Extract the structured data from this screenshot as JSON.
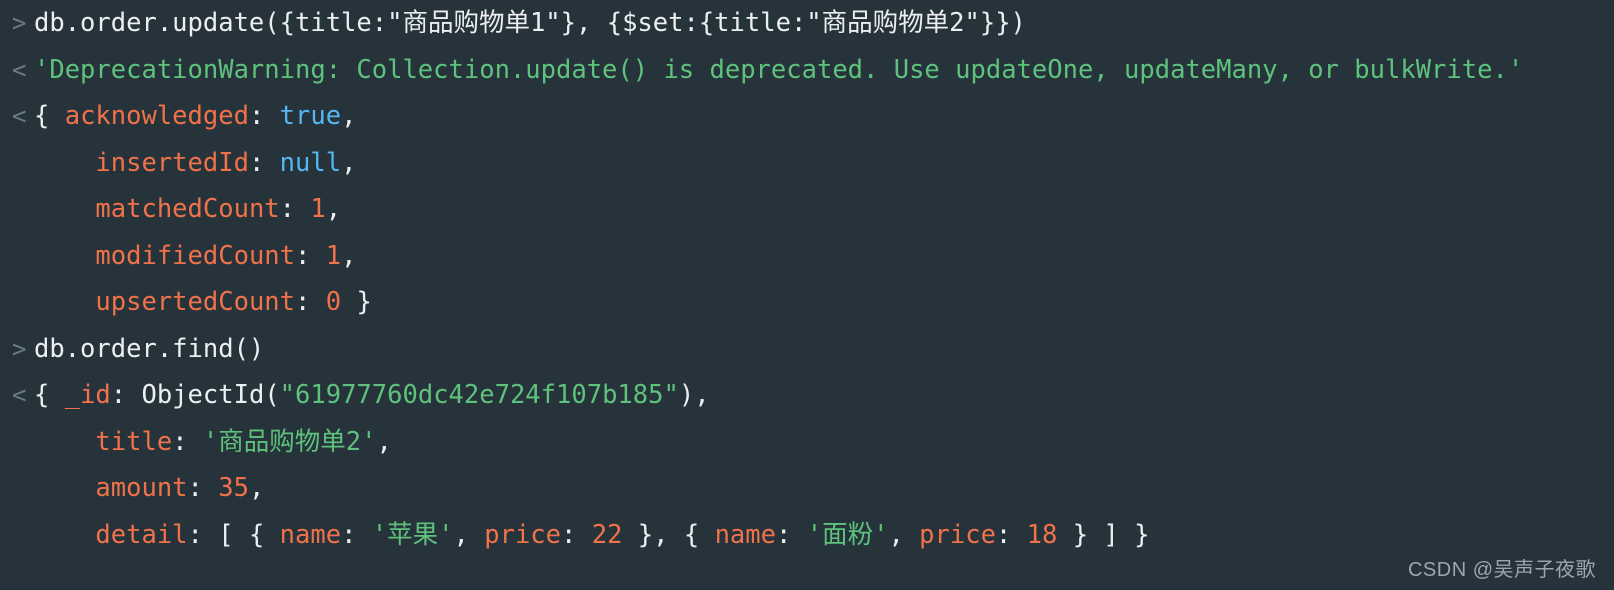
{
  "terminal": {
    "background_color": "#26333b",
    "prompt_in_glyph": ">",
    "prompt_out_glyph": "<",
    "colors": {
      "plain": "#eceff1",
      "key": "#f0724a",
      "number": "#f0724a",
      "string": "#5ec27c",
      "boolean": "#56b6f2",
      "prompt": "#6b7b84"
    },
    "lines": [
      {
        "gutter": ">",
        "kind": "input",
        "indent": 0,
        "tokens": [
          {
            "t": "db.order.update({title:\"商品购物单1\"}, {$set:{title:\"商品购物单2\"}})",
            "c": "plain"
          }
        ]
      },
      {
        "gutter": "<",
        "kind": "output",
        "indent": 0,
        "tokens": [
          {
            "t": "'DeprecationWarning: Collection.update() is deprecated. Use updateOne, updateMany, or bulkWrite.'",
            "c": "str"
          }
        ]
      },
      {
        "gutter": "<",
        "kind": "output",
        "indent": 0,
        "tokens": [
          {
            "t": "{ ",
            "c": "punct"
          },
          {
            "t": "acknowledged",
            "c": "key"
          },
          {
            "t": ": ",
            "c": "punct"
          },
          {
            "t": "true",
            "c": "bool"
          },
          {
            "t": ",",
            "c": "punct"
          }
        ]
      },
      {
        "gutter": "",
        "kind": "output",
        "indent": 1,
        "tokens": [
          {
            "t": "insertedId",
            "c": "key"
          },
          {
            "t": ": ",
            "c": "punct"
          },
          {
            "t": "null",
            "c": "bool"
          },
          {
            "t": ",",
            "c": "punct"
          }
        ]
      },
      {
        "gutter": "",
        "kind": "output",
        "indent": 1,
        "tokens": [
          {
            "t": "matchedCount",
            "c": "key"
          },
          {
            "t": ": ",
            "c": "punct"
          },
          {
            "t": "1",
            "c": "num"
          },
          {
            "t": ",",
            "c": "punct"
          }
        ]
      },
      {
        "gutter": "",
        "kind": "output",
        "indent": 1,
        "tokens": [
          {
            "t": "modifiedCount",
            "c": "key"
          },
          {
            "t": ": ",
            "c": "punct"
          },
          {
            "t": "1",
            "c": "num"
          },
          {
            "t": ",",
            "c": "punct"
          }
        ]
      },
      {
        "gutter": "",
        "kind": "output",
        "indent": 1,
        "tokens": [
          {
            "t": "upsertedCount",
            "c": "key"
          },
          {
            "t": ": ",
            "c": "punct"
          },
          {
            "t": "0",
            "c": "num"
          },
          {
            "t": " }",
            "c": "punct"
          }
        ]
      },
      {
        "gutter": ">",
        "kind": "input",
        "indent": 0,
        "tokens": [
          {
            "t": "db.order.find()",
            "c": "plain"
          }
        ]
      },
      {
        "gutter": "<",
        "kind": "output",
        "indent": 0,
        "tokens": [
          {
            "t": "{ ",
            "c": "punct"
          },
          {
            "t": "_id",
            "c": "key"
          },
          {
            "t": ": ",
            "c": "punct"
          },
          {
            "t": "ObjectId(",
            "c": "plain"
          },
          {
            "t": "\"61977760dc42e724f107b185\"",
            "c": "str"
          },
          {
            "t": "),",
            "c": "punct"
          }
        ]
      },
      {
        "gutter": "",
        "kind": "output",
        "indent": 1,
        "tokens": [
          {
            "t": "title",
            "c": "key"
          },
          {
            "t": ": ",
            "c": "punct"
          },
          {
            "t": "'商品购物单2'",
            "c": "str"
          },
          {
            "t": ",",
            "c": "punct"
          }
        ]
      },
      {
        "gutter": "",
        "kind": "output",
        "indent": 1,
        "tokens": [
          {
            "t": "amount",
            "c": "key"
          },
          {
            "t": ": ",
            "c": "punct"
          },
          {
            "t": "35",
            "c": "num"
          },
          {
            "t": ",",
            "c": "punct"
          }
        ]
      },
      {
        "gutter": "",
        "kind": "output",
        "indent": 1,
        "tokens": [
          {
            "t": "detail",
            "c": "key"
          },
          {
            "t": ": [ { ",
            "c": "punct"
          },
          {
            "t": "name",
            "c": "key"
          },
          {
            "t": ": ",
            "c": "punct"
          },
          {
            "t": "'苹果'",
            "c": "str"
          },
          {
            "t": ", ",
            "c": "punct"
          },
          {
            "t": "price",
            "c": "key"
          },
          {
            "t": ": ",
            "c": "punct"
          },
          {
            "t": "22",
            "c": "num"
          },
          {
            "t": " }, { ",
            "c": "punct"
          },
          {
            "t": "name",
            "c": "key"
          },
          {
            "t": ": ",
            "c": "punct"
          },
          {
            "t": "'面粉'",
            "c": "str"
          },
          {
            "t": ", ",
            "c": "punct"
          },
          {
            "t": "price",
            "c": "key"
          },
          {
            "t": ": ",
            "c": "punct"
          },
          {
            "t": "18",
            "c": "num"
          },
          {
            "t": " } ] }",
            "c": "punct"
          }
        ]
      }
    ]
  },
  "watermark": {
    "text": "CSDN @吴声子夜歌"
  }
}
